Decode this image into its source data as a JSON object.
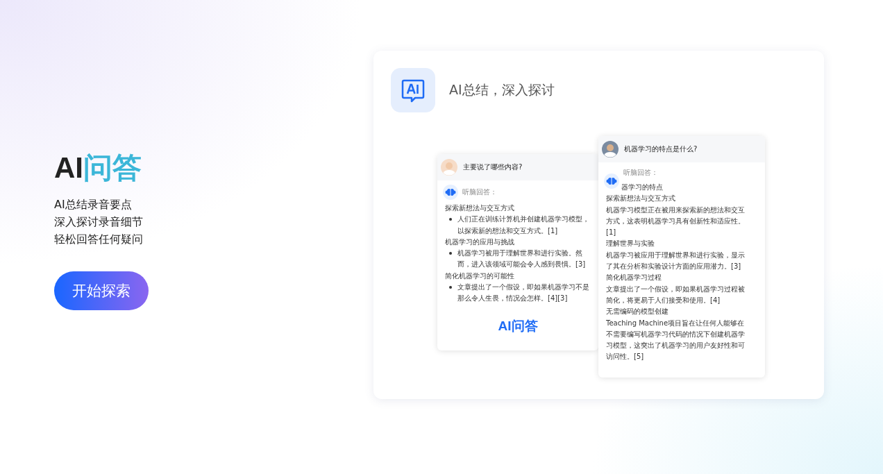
{
  "hero": {
    "title_prefix": "AI",
    "title_highlight": "问答",
    "lines": [
      "AI总结录音要点",
      "深入探讨录音细节",
      "轻松回答任何疑问"
    ],
    "button": "开始探索"
  },
  "feature": {
    "title": "AI总结，深入探讨"
  },
  "chat_cards": [
    {
      "kind": "bulleted",
      "question": "主要说了哪些内容?",
      "answer_label": "听脑回答：",
      "sections": [
        {
          "heading": "探索新想法与交互方式",
          "bullets": [
            "人们正在训练计算机并创建机器学习模型，以探索新的想法和交互方式。[1]"
          ]
        },
        {
          "heading": "机器学习的应用与挑战",
          "bullets": [
            "机器学习被用于理解世界和进行实验。然而，进入该领域可能会令人感到畏惧。[3]"
          ]
        },
        {
          "heading": "简化机器学习的可能性",
          "bullets": [
            "文章提出了一个假设，即如果机器学习不是那么令人生畏，情况会怎样。[4][3]"
          ]
        }
      ],
      "caption": "AI问答"
    },
    {
      "kind": "plain",
      "question": "机器学习的特点是什么?",
      "answer_label": "听脑回答：",
      "paragraphs": [
        "器学习的特点",
        "探索新想法与交互方式",
        "机器学习模型正在被用来探索新的想法和交互方式，这表明机器学习具有创新性和适应性。[1]",
        "理解世界与实验",
        "机器学习被应用于理解世界和进行实验，显示了其在分析和实验设计方面的应用潜力。[3]",
        "简化机器学习过程",
        "文章提出了一个假设，即如果机器学习过程被简化，将更易于人们接受和使用。[4]",
        "无需编码的模型创建",
        "Teaching Machine项目旨在让任何人能够在不需要编写机器学习代码的情况下创建机器学习模型，这突出了机器学习的用户友好性和可访问性。[5]"
      ]
    }
  ]
}
